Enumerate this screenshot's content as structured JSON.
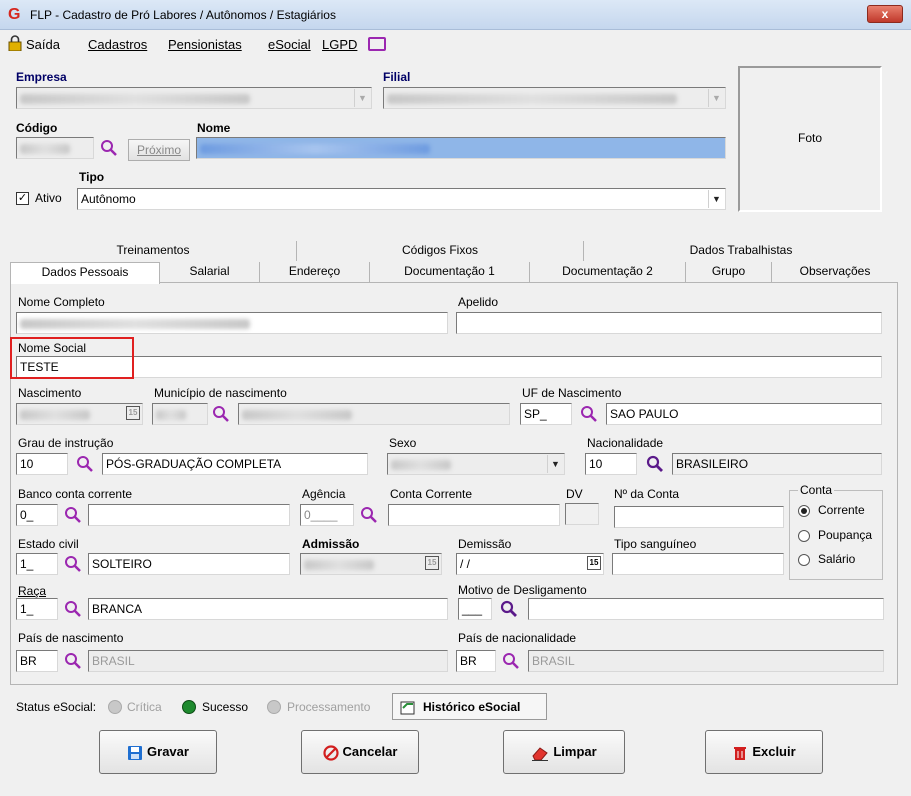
{
  "window": {
    "title": "FLP - Cadastro de Pró Labores / Autônomos / Estagiários",
    "close": "x"
  },
  "menu": [
    "Saída",
    "Cadastros",
    "Pensionistas",
    "eSocial",
    "LGPD"
  ],
  "header": {
    "empresa_label": "Empresa",
    "filial_label": "Filial",
    "codigo_label": "Código",
    "nome_label": "Nome",
    "proximo_label": "Próximo",
    "tipo_label": "Tipo",
    "ativo_label": "Ativo",
    "tipo_value": "Autônomo",
    "foto_label": "Foto"
  },
  "tabs_top": [
    "Treinamentos",
    "Códigos Fixos",
    "Dados Trabalhistas"
  ],
  "tabs_bottom": [
    "Dados Pessoais",
    "Salarial",
    "Endereço",
    "Documentação 1",
    "Documentação 2",
    "Grupo",
    "Observações"
  ],
  "form": {
    "nome_completo_label": "Nome Completo",
    "apelido_label": "Apelido",
    "nome_social_label": "Nome Social",
    "nome_social_value": "TESTE",
    "nascimento_label": "Nascimento",
    "municipio_label": "Município de nascimento",
    "uf_nasc_label": "UF de Nascimento",
    "uf_code": "SP_",
    "uf_name": "SAO PAULO",
    "grau_label": "Grau de instrução",
    "grau_code": "10",
    "grau_name": "PÓS-GRADUAÇÃO COMPLETA",
    "sexo_label": "Sexo",
    "nacionalidade_label": "Nacionalidade",
    "nac_code": "10",
    "nac_name": "BRASILEIRO",
    "banco_label": "Banco conta corrente",
    "banco_code": "0_",
    "agencia_label": "Agência",
    "agencia_value": "0____",
    "conta_corrente_label": "Conta Corrente",
    "dv_label": "DV",
    "n_conta_label": "Nº da Conta",
    "conta_group_label": "Conta",
    "conta_options": [
      "Corrente",
      "Poupança",
      "Salário"
    ],
    "estado_civil_label": "Estado civil",
    "estado_civil_code": "1_",
    "estado_civil_name": "SOLTEIRO",
    "admissao_label": "Admissão",
    "demissao_label": "Demissão",
    "demissao_value": " / /",
    "tipo_sang_label": "Tipo sanguíneo",
    "raca_label": "Raça",
    "raca_code": "1_",
    "raca_name": "BRANCA",
    "motivo_label": "Motivo de Desligamento",
    "motivo_value": "___",
    "pais_nasc_label": "País de nascimento",
    "pais_nasc_code": "BR",
    "pais_nasc_name": "BRASIL",
    "pais_nac_label": "País de nacionalidade",
    "pais_nac_code": "BR",
    "pais_nac_name": "BRASIL",
    "cal_glyph": "15"
  },
  "status": {
    "label": "Status eSocial:",
    "critica": "Crítica",
    "sucesso": "Sucesso",
    "processamento": "Processamento",
    "historico": "Histórico eSocial"
  },
  "buttons": {
    "gravar": "Gravar",
    "cancelar": "Cancelar",
    "limpar": "Limpar",
    "excluir": "Excluir"
  },
  "colors": {
    "accent_purple": "#9b27b0",
    "success_green": "#1e8a2e",
    "highlight_red": "#e02020"
  }
}
